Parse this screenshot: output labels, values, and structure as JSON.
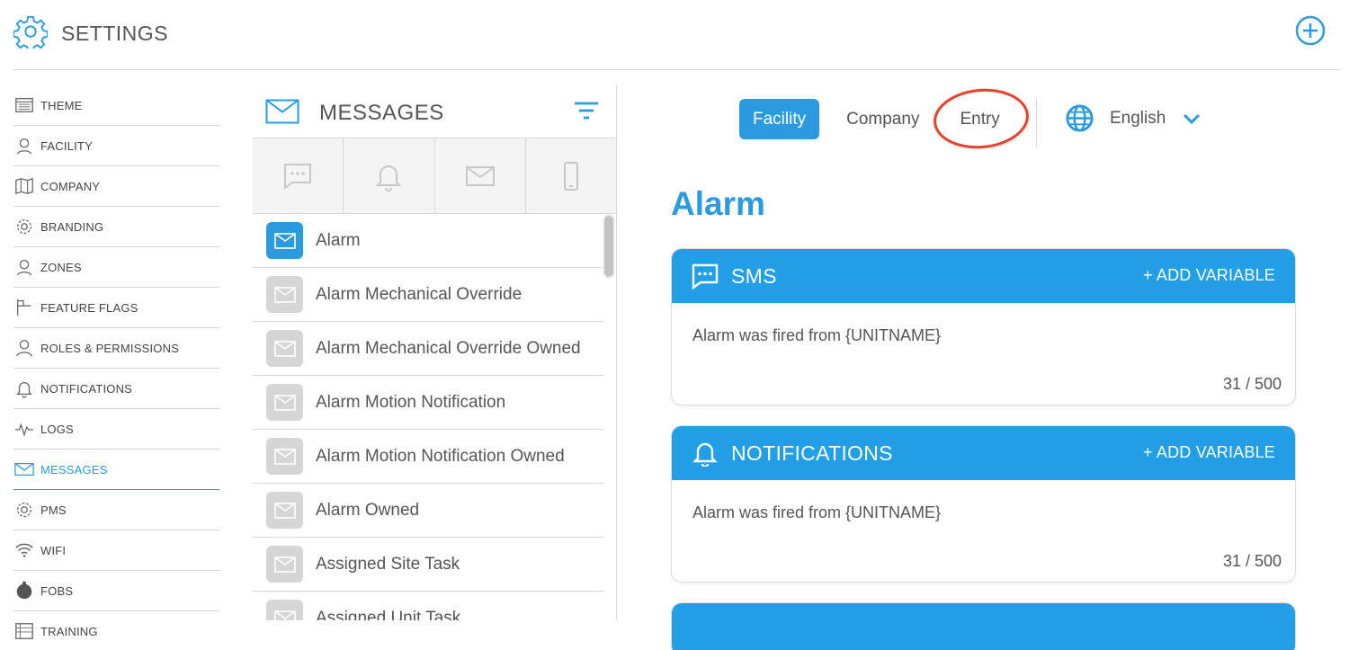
{
  "header": {
    "title": "SETTINGS"
  },
  "sidebar": {
    "items": [
      {
        "label": "THEME",
        "icon": "theme-icon"
      },
      {
        "label": "FACILITY",
        "icon": "facility-icon"
      },
      {
        "label": "COMPANY",
        "icon": "map-icon"
      },
      {
        "label": "BRANDING",
        "icon": "gear-icon"
      },
      {
        "label": "ZONES",
        "icon": "zones-icon"
      },
      {
        "label": "FEATURE FLAGS",
        "icon": "flag-icon"
      },
      {
        "label": "ROLES & PERMISSIONS",
        "icon": "user-icon"
      },
      {
        "label": "NOTIFICATIONS",
        "icon": "bell-icon"
      },
      {
        "label": "LOGS",
        "icon": "pulse-icon"
      },
      {
        "label": "MESSAGES",
        "icon": "envelope-icon",
        "active": true
      },
      {
        "label": "PMS",
        "icon": "gear-icon"
      },
      {
        "label": "WIFI",
        "icon": "wifi-icon"
      },
      {
        "label": "FOBS",
        "icon": "fob-icon"
      },
      {
        "label": "TRAINING",
        "icon": "training-icon"
      }
    ]
  },
  "messages": {
    "title": "MESSAGES",
    "channels": [
      "sms-icon",
      "bell-icon",
      "envelope-icon",
      "phone-icon"
    ],
    "list": [
      {
        "label": "Alarm",
        "selected": true
      },
      {
        "label": "Alarm Mechanical Override"
      },
      {
        "label": "Alarm Mechanical Override Owned"
      },
      {
        "label": "Alarm Motion Notification"
      },
      {
        "label": "Alarm Motion Notification Owned"
      },
      {
        "label": "Alarm Owned"
      },
      {
        "label": "Assigned Site Task"
      },
      {
        "label": "Assigned Unit Task"
      }
    ]
  },
  "tabs": {
    "facility": "Facility",
    "company": "Company",
    "entry": "Entry"
  },
  "language": {
    "selected": "English"
  },
  "detail": {
    "title": "Alarm",
    "cards": [
      {
        "name": "SMS",
        "add_variable": "+ ADD VARIABLE",
        "message": "Alarm was fired from {UNITNAME}",
        "count": "31 / 500"
      },
      {
        "name": "NOTIFICATIONS",
        "add_variable": "+ ADD VARIABLE",
        "message": "Alarm was fired from {UNITNAME}",
        "count": "31 / 500"
      }
    ]
  },
  "colors": {
    "accent": "#2b9be0",
    "card_header": "#229fe6",
    "highlight_circle": "#e8412f"
  }
}
